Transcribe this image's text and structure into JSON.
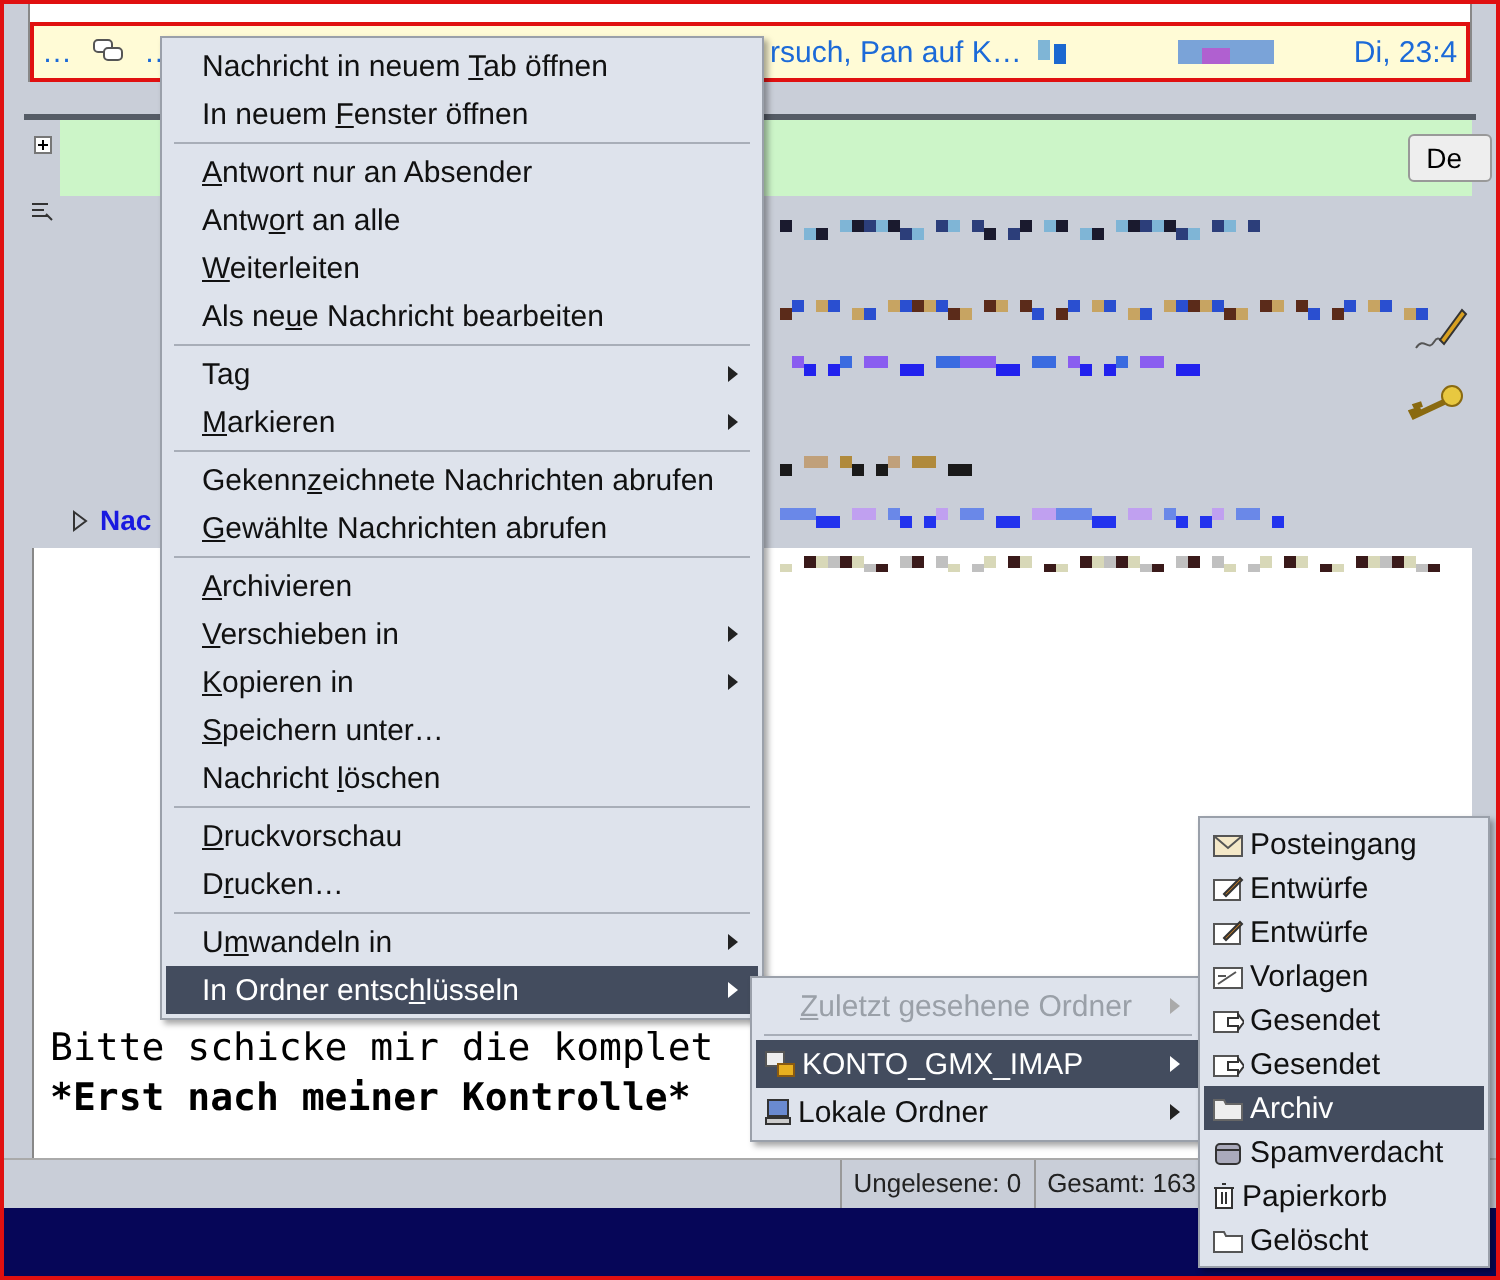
{
  "thread_row": {
    "lead": "…",
    "thread": "…",
    "subject": "rsuch, Pan auf K…",
    "date": "Di, 23:4"
  },
  "header": {
    "button": "De",
    "toggle": "Nac"
  },
  "body": {
    "lines": [
      {
        "text": "Bitte schicke mir die komplet",
        "bold": false
      },
      {
        "text": "*Erst nach meiner Kontrolle*",
        "bold": true
      }
    ]
  },
  "status_bar": {
    "unread": "Ungelesene: 0",
    "total": "Gesamt: 163"
  },
  "context_menu": {
    "groups": [
      [
        {
          "pre": "Nachricht in neuem ",
          "key": "T",
          "post": "ab öffnen",
          "submenu": false,
          "selected": false
        },
        {
          "pre": "In neuem ",
          "key": "F",
          "post": "enster öffnen",
          "submenu": false,
          "selected": false
        }
      ],
      [
        {
          "key": "A",
          "post": "ntwort nur an Absender",
          "submenu": false,
          "selected": false
        },
        {
          "pre": "Antw",
          "key": "o",
          "post": "rt an alle",
          "submenu": false,
          "selected": false
        },
        {
          "key": "W",
          "post": "eiterleiten",
          "submenu": false,
          "selected": false
        },
        {
          "pre": "Als ne",
          "key": "u",
          "post": "e Nachricht bearbeiten",
          "submenu": false,
          "selected": false
        }
      ],
      [
        {
          "pre": "Ta",
          "key": "g",
          "submenu": true,
          "selected": false
        },
        {
          "key": "M",
          "post": "arkieren",
          "submenu": true,
          "selected": false
        }
      ],
      [
        {
          "pre": "Gekenn",
          "key": "z",
          "post": "eichnete Nachrichten abrufen",
          "submenu": false,
          "selected": false
        },
        {
          "key": "G",
          "post": "ewählte Nachrichten abrufen",
          "submenu": false,
          "selected": false
        }
      ],
      [
        {
          "key": "A",
          "post": "rchivieren",
          "submenu": false,
          "selected": false
        },
        {
          "key": "V",
          "post": "erschieben in",
          "submenu": true,
          "selected": false
        },
        {
          "key": "K",
          "post": "opieren in",
          "submenu": true,
          "selected": false
        },
        {
          "key": "S",
          "post": "peichern unter…",
          "submenu": false,
          "selected": false
        },
        {
          "pre": "Nachricht ",
          "key": "l",
          "post": "öschen",
          "submenu": false,
          "selected": false
        }
      ],
      [
        {
          "key": "D",
          "post": "ruckvorschau",
          "submenu": false,
          "selected": false
        },
        {
          "pre": "D",
          "key": "r",
          "post": "ucken…",
          "submenu": false,
          "selected": false
        }
      ],
      [
        {
          "pre": "U",
          "key": "m",
          "post": "wandeln in",
          "submenu": true,
          "selected": false
        },
        {
          "pre": "In Ordner entsc",
          "key": "h",
          "post": "lüsseln",
          "submenu": true,
          "selected": true
        }
      ]
    ]
  },
  "account_menu": {
    "recent": {
      "key": "Z",
      "post": "uletzt gesehene Ordner",
      "disabled": true
    },
    "accounts": [
      {
        "label": "KONTO_GMX_IMAP",
        "kind": "imap",
        "selected": true
      },
      {
        "label": "Lokale Ordner",
        "kind": "local",
        "selected": false
      }
    ]
  },
  "folder_menu": {
    "items": [
      {
        "label": "Posteingang",
        "kind": "inbox",
        "selected": false
      },
      {
        "label": "Entwürfe",
        "kind": "drafts",
        "selected": false
      },
      {
        "label": "Entwürfe",
        "kind": "drafts",
        "selected": false
      },
      {
        "label": "Vorlagen",
        "kind": "templates",
        "selected": false
      },
      {
        "label": "Gesendet",
        "kind": "sent",
        "selected": false
      },
      {
        "label": "Gesendet",
        "kind": "sent",
        "selected": false
      },
      {
        "label": "Archiv",
        "kind": "archive",
        "selected": true
      },
      {
        "label": "Spamverdacht",
        "kind": "spam",
        "selected": false
      },
      {
        "label": "Papierkorb",
        "kind": "trash",
        "selected": false
      },
      {
        "label": "Gelöscht",
        "kind": "folder",
        "selected": false
      }
    ]
  }
}
